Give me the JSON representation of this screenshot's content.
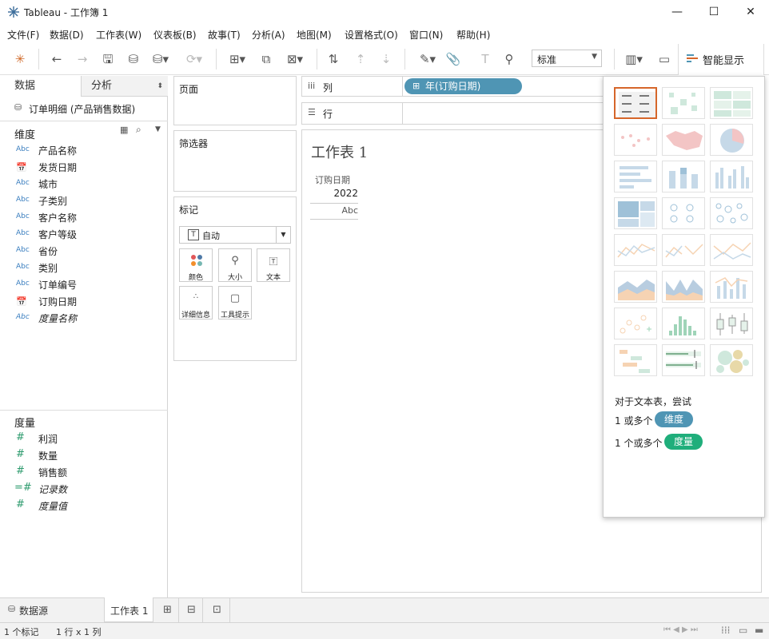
{
  "window": {
    "title": "Tableau - 工作簿 1"
  },
  "menu": [
    "文件(F)",
    "数据(D)",
    "工作表(W)",
    "仪表板(B)",
    "故事(T)",
    "分析(A)",
    "地图(M)",
    "设置格式(O)",
    "窗口(N)",
    "帮助(H)"
  ],
  "toolbar": {
    "fit_value": "标准",
    "show_me_label": "智能显示"
  },
  "left": {
    "tab_data": "数据",
    "tab_analysis": "分析",
    "datasource": "订单明细 (产品销售数据)",
    "dimensions_label": "维度",
    "dimensions": [
      {
        "label": "产品名称",
        "type": "Abc"
      },
      {
        "label": "发货日期",
        "type": "date"
      },
      {
        "label": "城市",
        "type": "Abc"
      },
      {
        "label": "子类别",
        "type": "Abc"
      },
      {
        "label": "客户名称",
        "type": "Abc"
      },
      {
        "label": "客户等级",
        "type": "Abc"
      },
      {
        "label": "省份",
        "type": "Abc"
      },
      {
        "label": "类别",
        "type": "Abc"
      },
      {
        "label": "订单编号",
        "type": "Abc"
      },
      {
        "label": "订购日期",
        "type": "date"
      },
      {
        "label": "度量名称",
        "type": "Abc"
      }
    ],
    "measures_label": "度量",
    "measures": [
      {
        "label": "利润"
      },
      {
        "label": "数量"
      },
      {
        "label": "销售额"
      },
      {
        "label": "记录数"
      },
      {
        "label": "度量值"
      }
    ]
  },
  "shelves": {
    "pages": "页面",
    "filters": "筛选器",
    "marks": "标记",
    "marks_type": "自动",
    "mark_buttons": [
      "颜色",
      "大小",
      "文本",
      "详细信息",
      "工具提示"
    ],
    "columns_label": "列",
    "rows_label": "行",
    "column_pill": "年(订购日期)"
  },
  "view": {
    "title": "工作表 1",
    "header": "订购日期",
    "value": "2022",
    "placeholder": "Abc"
  },
  "showme": {
    "hint": "对于文本表，尝试",
    "req1_prefix": "1 或多个",
    "req1_pill": "维度",
    "req2_prefix": "1 个或多个",
    "req2_pill": "度量",
    "dim_color": "#4f95b4",
    "meas_color": "#1fae7b"
  },
  "bottom": {
    "datasource_tab": "数据源",
    "sheet_tab": "工作表 1",
    "status_marks": "1 个标记",
    "status_dims": "1 行 x 1 列"
  }
}
